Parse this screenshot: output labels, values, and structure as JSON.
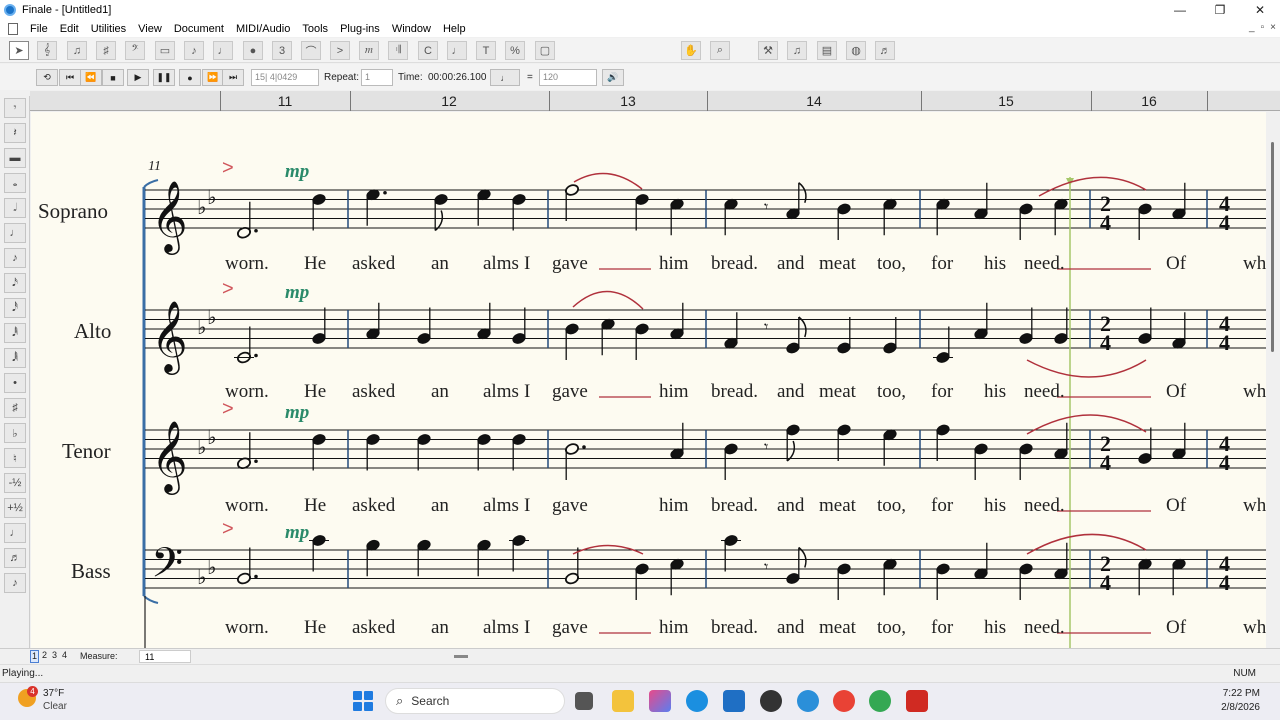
{
  "window": {
    "title": "Finale - [Untitled1]",
    "controls": [
      "—",
      "❐",
      "✕"
    ]
  },
  "menu": [
    "File",
    "Edit",
    "Utilities",
    "View",
    "Document",
    "MIDI/Audio",
    "Tools",
    "Plug-ins",
    "Window",
    "Help"
  ],
  "mdi_controls": [
    "_",
    "▫",
    "×"
  ],
  "toolbar_icons": [
    "selection-tool",
    "staff-tool",
    "smart-shape-tool",
    "key-tool",
    "time-sig-tool",
    "clef-tool",
    "measure-tool",
    "note-mover-tool",
    "speedy-entry-tool",
    "simple-entry-tool",
    "articulation-tool",
    "tuplet-tool",
    "smart-shape-slur",
    "expression-tool",
    "repeat-tool",
    "chord-tool",
    "lyrics-tool",
    "text-tool",
    "resize-tool",
    "page-layout-tool",
    "hand-grabber",
    "zoom-tool",
    "mixer",
    "palette-a",
    "palette-b",
    "palette-c",
    "palette-d"
  ],
  "playback": {
    "counter": "15| 4|0429",
    "repeat_label": "Repeat:",
    "repeat_value": "1",
    "time_label": "Time:",
    "time_value": "00:00:26.100",
    "tempo_equals": "=",
    "tempo_value": "120"
  },
  "ruler": {
    "measures": [
      "11",
      "12",
      "13",
      "14",
      "15",
      "16"
    ]
  },
  "score": {
    "start_measure": "11",
    "parts": [
      {
        "name": "Soprano",
        "clef": "treble",
        "lyrics": [
          "worn.",
          "He",
          "asked",
          "an",
          "alms",
          "I",
          "gave",
          "him",
          "bread.",
          "and",
          "meat",
          "too,",
          "for",
          "his",
          "need.",
          "Of",
          "wh"
        ]
      },
      {
        "name": "Alto",
        "clef": "treble",
        "lyrics": [
          "worn.",
          "He",
          "asked",
          "an",
          "alms",
          "I",
          "gave",
          "him",
          "bread.",
          "and",
          "meat",
          "too,",
          "for",
          "his",
          "need.",
          "Of",
          "wh"
        ]
      },
      {
        "name": "Tenor",
        "clef": "treble",
        "lyrics": [
          "worn.",
          "He",
          "asked",
          "an",
          "alms",
          "I",
          "gave",
          "him",
          "bread.",
          "and",
          "meat",
          "too,",
          "for",
          "his",
          "need.",
          "Of",
          "wh"
        ]
      },
      {
        "name": "Bass",
        "clef": "bass",
        "lyrics": [
          "worn.",
          "He",
          "asked",
          "an",
          "alms",
          "I",
          "gave",
          "him",
          "bread.",
          "and",
          "meat",
          "too,",
          "for",
          "his",
          "need.",
          "Of",
          "wh"
        ]
      }
    ],
    "dynamic": "mp",
    "accent": ">",
    "time_sig_a": [
      "2",
      "4"
    ],
    "time_sig_b": [
      "4",
      "4"
    ],
    "colors": {
      "slur": "#b0313c",
      "staff": "#111111",
      "barline": "#234b7a",
      "dynamic": "#2a8a6a",
      "page": "#fdfbf1",
      "playback_line": "#a6c86a"
    }
  },
  "bottom": {
    "pages": [
      "1",
      "2",
      "3",
      "4"
    ],
    "measure_label": "Measure:",
    "measure_value": "11"
  },
  "status": {
    "left": "Playing...",
    "right": "NUM"
  },
  "taskbar": {
    "weather_badge": "4",
    "weather_temp": "37°F",
    "weather_cond": "Clear",
    "search_placeholder": "Search",
    "time": "7:22 PM",
    "date": "2/8/2026"
  }
}
